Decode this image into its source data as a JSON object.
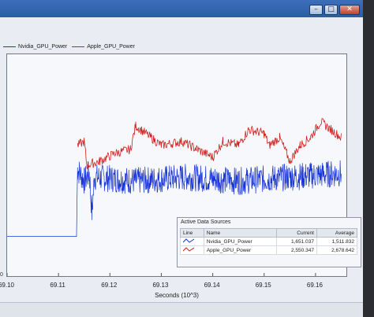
{
  "window": {
    "controls": [
      "–",
      "□",
      "✕"
    ],
    "colors": {
      "title_bar": "#2d5ca6",
      "plot_bg": "#f6f8fb"
    }
  },
  "legend": [
    {
      "name": "Nvidia_GPU_Power",
      "color": "#1a35d6"
    },
    {
      "name": "Apple_GPU_Power",
      "color": "#d01d1d"
    }
  ],
  "chart_data": {
    "type": "line",
    "xlabel": "Seconds (10^3)",
    "x_ticks": [
      "69.10",
      "69.11",
      "69.12",
      "69.13",
      "69.14",
      "69.15",
      "69.16"
    ],
    "xlim": [
      69.1,
      69.166
    ],
    "y_ticks_visible": [
      "0"
    ],
    "grid": false,
    "legend_position": "top-left",
    "series": [
      {
        "name": "Nvidia_GPU_Power",
        "color": "#1a35d6",
        "points": [
          [
            69.1,
            1.0
          ],
          [
            69.1135,
            1.0
          ],
          [
            69.1137,
            2.7
          ],
          [
            69.115,
            2.4
          ],
          [
            69.116,
            2.6
          ],
          [
            69.1165,
            1.6
          ],
          [
            69.117,
            2.5
          ],
          [
            69.125,
            2.4
          ],
          [
            69.135,
            2.5
          ],
          [
            69.145,
            2.4
          ],
          [
            69.155,
            2.5
          ],
          [
            69.165,
            2.6
          ]
        ],
        "noise_amplitude": 0.35
      },
      {
        "name": "Apple_GPU_Power",
        "color": "#d01d1d",
        "points": [
          [
            69.1137,
            3.3
          ],
          [
            69.115,
            3.4
          ],
          [
            69.1155,
            2.8
          ],
          [
            69.118,
            2.9
          ],
          [
            69.121,
            3.1
          ],
          [
            69.124,
            3.2
          ],
          [
            69.125,
            3.8
          ],
          [
            69.128,
            3.5
          ],
          [
            69.13,
            3.3
          ],
          [
            69.134,
            3.4
          ],
          [
            69.137,
            3.2
          ],
          [
            69.14,
            3.0
          ],
          [
            69.142,
            3.4
          ],
          [
            69.145,
            3.3
          ],
          [
            69.147,
            3.7
          ],
          [
            69.15,
            3.6
          ],
          [
            69.151,
            3.3
          ],
          [
            69.153,
            3.5
          ],
          [
            69.155,
            2.9
          ],
          [
            69.157,
            3.3
          ],
          [
            69.159,
            3.5
          ],
          [
            69.161,
            3.9
          ],
          [
            69.163,
            3.7
          ],
          [
            69.165,
            3.5
          ]
        ],
        "noise_amplitude": 0.12
      }
    ]
  },
  "active_data_sources": {
    "title": "Active Data Sources",
    "columns": [
      "Line",
      "Name",
      "Current",
      "Average"
    ],
    "rows": [
      {
        "color": "#1a35d6",
        "name": "Nvidia_GPU_Power",
        "current": "1,651.037",
        "average": "1,511.832"
      },
      {
        "color": "#d01d1d",
        "name": "Apple_GPU_Power",
        "current": "2,550.347",
        "average": "2,678.642"
      }
    ]
  }
}
